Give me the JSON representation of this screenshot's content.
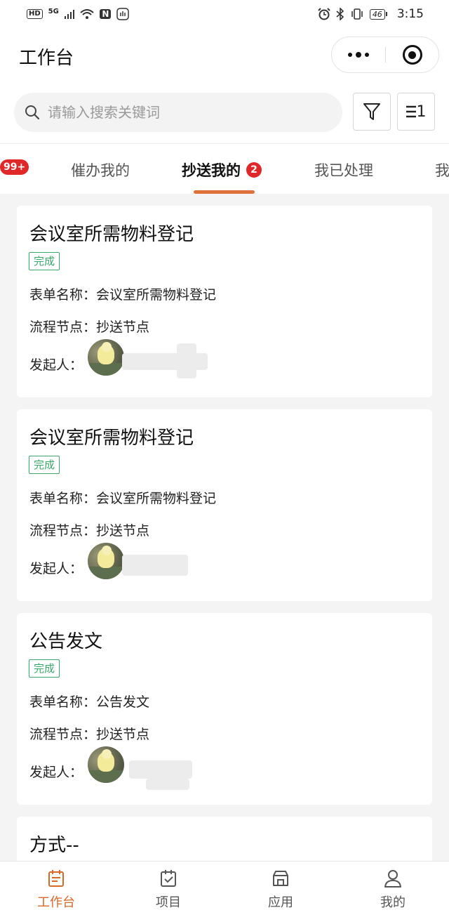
{
  "status_bar": {
    "left": "HD",
    "network": "5G",
    "nfc": "N",
    "battery": "46",
    "time": "3:15"
  },
  "header": {
    "title": "工作台"
  },
  "search": {
    "placeholder": "请输入搜索关键词",
    "sort_label": "1"
  },
  "tabs": [
    {
      "badge": "99+"
    },
    {
      "label": "催办我的"
    },
    {
      "label": "抄送我的",
      "badge": "2",
      "active": true
    },
    {
      "label": "我已处理"
    },
    {
      "label": "我"
    }
  ],
  "cards": [
    {
      "title": "会议室所需物料登记",
      "status": "完成",
      "form_label": "表单名称：",
      "form_name": "会议室所需物料登记",
      "node_label": "流程节点：",
      "node": "抄送节点",
      "initiator_label": "发起人："
    },
    {
      "title": "会议室所需物料登记",
      "status": "完成",
      "form_label": "表单名称：",
      "form_name": "会议室所需物料登记",
      "node_label": "流程节点：",
      "node": "抄送节点",
      "initiator_label": "发起人："
    },
    {
      "title": "公告发文",
      "status": "完成",
      "form_label": "表单名称：",
      "form_name": "公告发文",
      "node_label": "流程节点：",
      "node": "抄送节点",
      "initiator_label": "发起人："
    },
    {
      "title": "方式--"
    }
  ],
  "bottom_nav": [
    {
      "label": "工作台",
      "icon": "workbench-icon",
      "active": true
    },
    {
      "label": "项目",
      "icon": "project-icon"
    },
    {
      "label": "应用",
      "icon": "apps-icon"
    },
    {
      "label": "我的",
      "icon": "user-icon"
    }
  ],
  "colors": {
    "accent": "#d7692a",
    "badge": "#e02828",
    "status_green": "#3aa76d"
  }
}
